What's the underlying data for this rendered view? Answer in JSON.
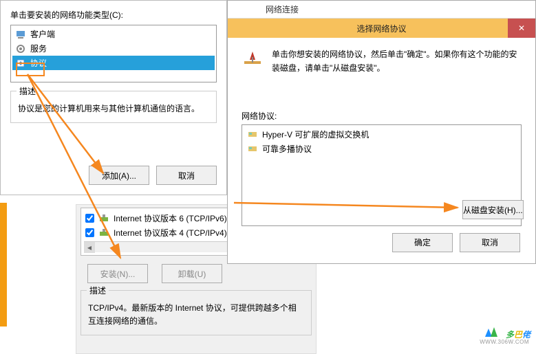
{
  "dlg1": {
    "label": "单击要安装的网络功能类型(C):",
    "items": [
      "客户端",
      "服务",
      "协议"
    ],
    "desc_title": "描述",
    "desc_text": "协议是您的计算机用来与其他计算机通信的语言。",
    "add_btn": "添加(A)...",
    "cancel_btn": "取消"
  },
  "panel2": {
    "items": [
      "Internet 协议版本 6 (TCP/IPv6)",
      "Internet 协议版本 4 (TCP/IPv4)"
    ],
    "install_btn": "安装(N)...",
    "uninstall_btn": "卸载(U)",
    "desc_title": "描述",
    "desc_text": "TCP/IPv4。最新版本的 Internet 协议，可提供跨越多个相互连接网络的通信。"
  },
  "dlg2": {
    "parent_title": "网络连接",
    "title": "选择网络协议",
    "instr": "单击你想安装的网络协议，然后单击\"确定\"。如果你有这个功能的安装磁盘，请单击\"从磁盘安装\"。",
    "proto_label": "网络协议:",
    "protos": [
      "Hyper-V 可扩展的虚拟交换机",
      "可靠多播协议"
    ],
    "install_disk_btn": "从磁盘安装(H)...",
    "ok_btn": "确定",
    "cancel_btn": "取消"
  },
  "watermark": {
    "t1": "多",
    "t2": "巴",
    "t3": "佬",
    "url": "WWW.306W.COM"
  }
}
